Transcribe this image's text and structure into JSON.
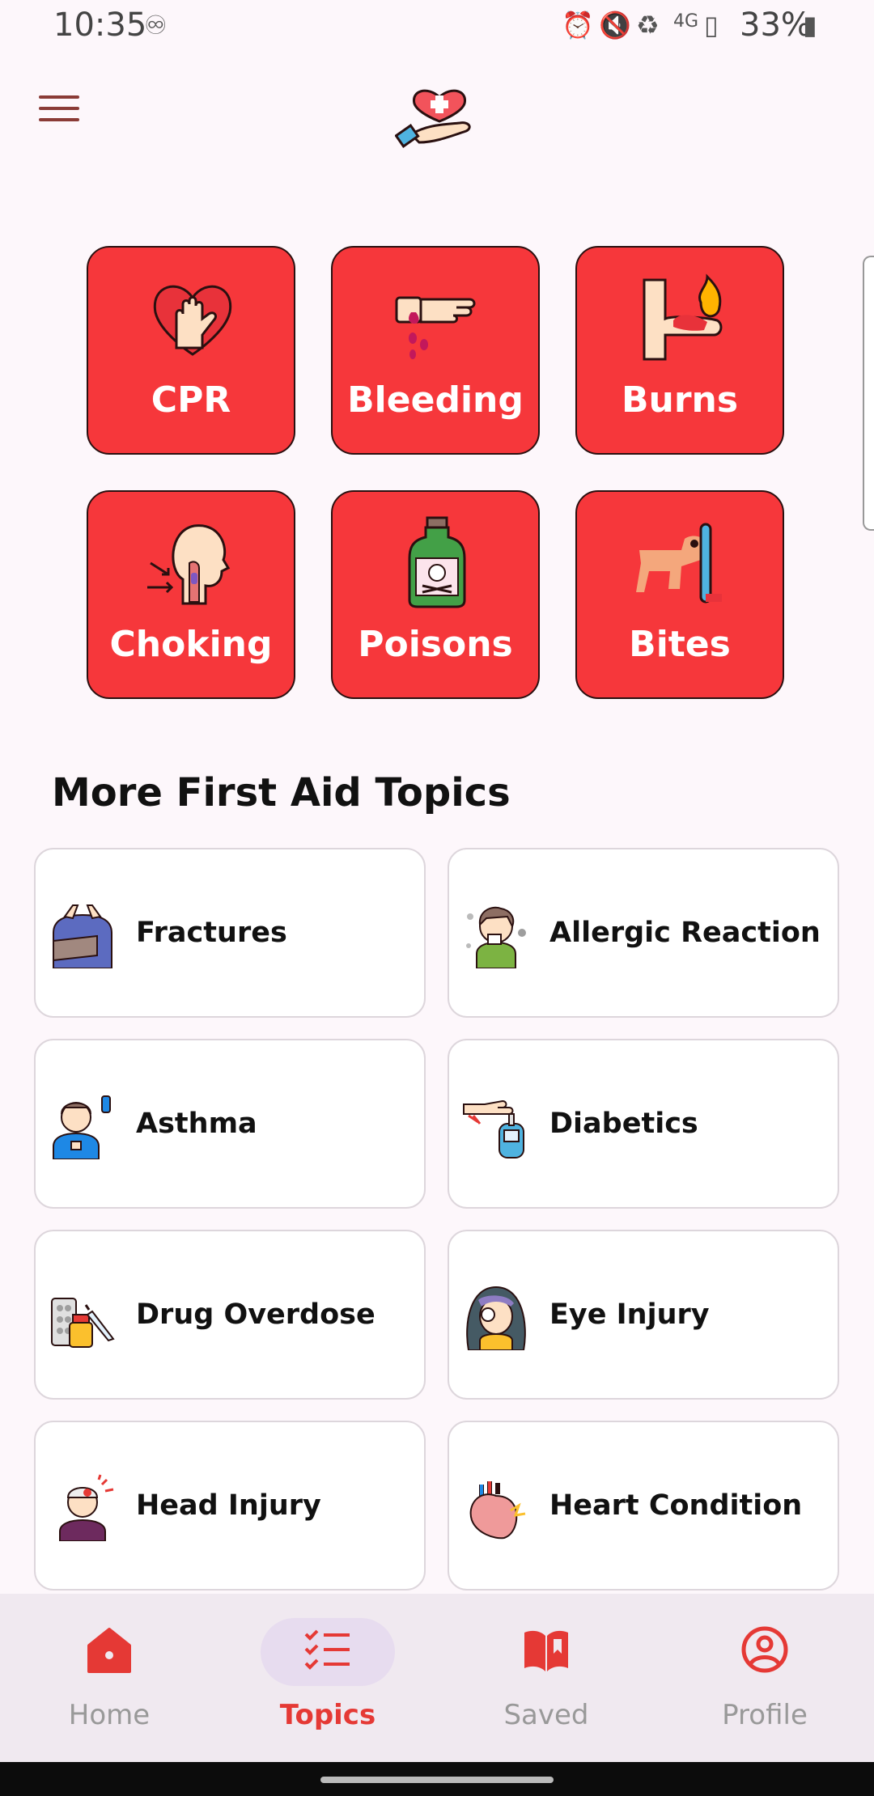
{
  "status_bar": {
    "time": "10:35",
    "network": "4G",
    "battery": "33%",
    "icons": [
      "accessibility-icon",
      "alarm-icon",
      "mute-icon",
      "battery-saver-icon",
      "signal-icon",
      "battery-icon"
    ]
  },
  "header": {
    "menu_icon": "hamburger-menu-icon",
    "logo": "heart-hand-logo"
  },
  "emergency_tiles": [
    {
      "label": "CPR",
      "icon": "cpr-heart-hands-icon"
    },
    {
      "label": "Bleeding",
      "icon": "bleeding-hand-icon"
    },
    {
      "label": "Burns",
      "icon": "burns-arm-icon"
    },
    {
      "label": "Choking",
      "icon": "choking-throat-icon"
    },
    {
      "label": "Poisons",
      "icon": "poison-bottle-icon"
    },
    {
      "label": "Bites",
      "icon": "dog-bite-icon"
    }
  ],
  "section_title": "More First Aid Topics",
  "topics": [
    {
      "label": "Fractures",
      "icon": "arm-sling-icon"
    },
    {
      "label": "Allergic Reaction",
      "icon": "allergy-sneeze-icon"
    },
    {
      "label": "Asthma",
      "icon": "asthma-inhaler-icon"
    },
    {
      "label": "Diabetics",
      "icon": "glucose-meter-icon"
    },
    {
      "label": "Drug Overdose",
      "icon": "pills-syringe-icon"
    },
    {
      "label": "Eye Injury",
      "icon": "eye-patch-icon"
    },
    {
      "label": "Head Injury",
      "icon": "head-bandage-icon"
    },
    {
      "label": "Heart Condition",
      "icon": "heart-organ-icon"
    }
  ],
  "bottom_nav": [
    {
      "label": "Home",
      "icon": "home-icon",
      "active": false
    },
    {
      "label": "Topics",
      "icon": "checklist-icon",
      "active": true
    },
    {
      "label": "Saved",
      "icon": "bookmark-book-icon",
      "active": false
    },
    {
      "label": "Profile",
      "icon": "profile-icon",
      "active": false
    }
  ],
  "colors": {
    "accent": "#f6373b",
    "active_nav": "#e53935",
    "background": "#fdf7fb",
    "nav_background": "#f0e9f0"
  }
}
